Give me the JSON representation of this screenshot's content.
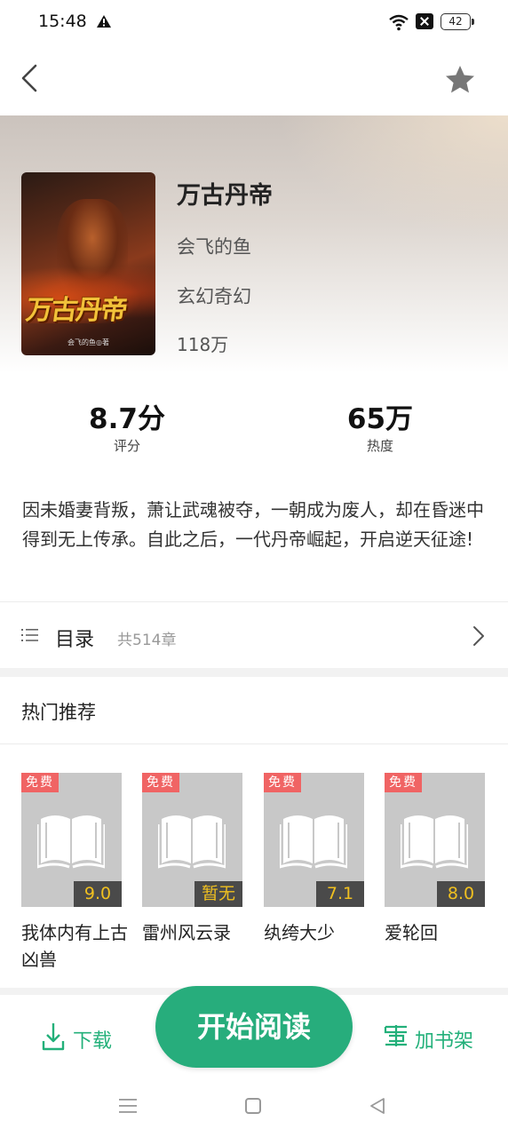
{
  "status_bar": {
    "time": "15:48",
    "battery": "42"
  },
  "book": {
    "title": "万古丹帝",
    "author": "会飞的鱼",
    "genre": "玄幻奇幻",
    "word_count": "118万",
    "cover_title": "万古丹帝",
    "cover_author": "会飞的鱼◎著"
  },
  "stats": {
    "rating_value": "8.7分",
    "rating_label": "评分",
    "heat_value": "65万",
    "heat_label": "热度"
  },
  "intro": "因未婚妻背叛，萧让武魂被夺，一朝成为废人，却在昏迷中得到无上传承。自此之后，一代丹帝崛起，开启逆天征途!",
  "catalog": {
    "label": "目录",
    "count": "共514章"
  },
  "hot": {
    "title": "热门推荐",
    "items": [
      {
        "badge": "免费",
        "score": "9.0",
        "name": "我体内有上古凶兽"
      },
      {
        "badge": "免费",
        "score": "暂无",
        "name": "雷州风云录"
      },
      {
        "badge": "免费",
        "score": "7.1",
        "name": "纨绔大少"
      },
      {
        "badge": "免费",
        "score": "8.0",
        "name": "爱轮回"
      }
    ]
  },
  "actions": {
    "download": "下载",
    "read": "开始阅读",
    "shelf": "加书架"
  },
  "colors": {
    "accent": "#27ad7c",
    "free_badge": "#f06464",
    "score_text": "#f0c020"
  },
  "icons": [
    "back-icon",
    "star-icon",
    "catalog-list-icon",
    "chevron-right-icon",
    "book-placeholder-icon",
    "download-icon",
    "add-shelf-icon",
    "menu-icon",
    "home-icon",
    "back-triangle-icon"
  ]
}
